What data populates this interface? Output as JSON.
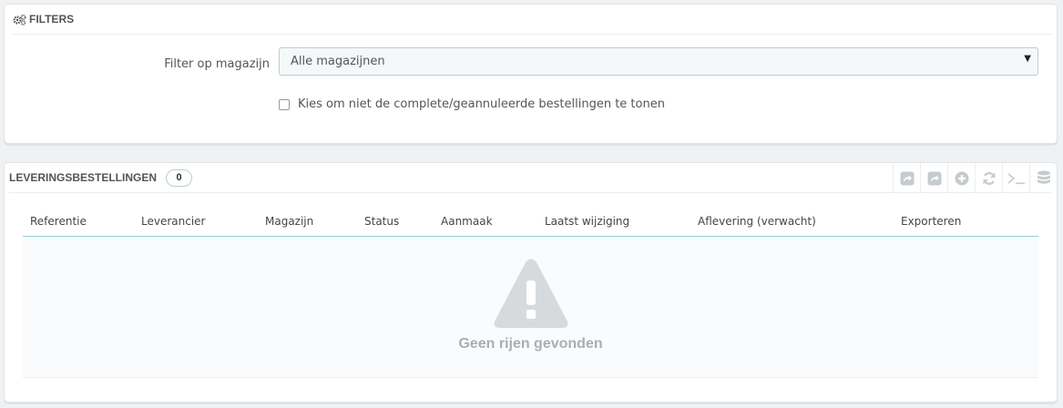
{
  "filters": {
    "title": "FILTERS",
    "warehouse_label": "Filter op magazijn",
    "warehouse_selected": "Alle magazijnen",
    "hide_completed_label": "Kies om niet de complete/geannuleerde bestellingen te tonen",
    "hide_completed_checked": false
  },
  "orders": {
    "title": "LEVERINGSBESTELLINGEN",
    "count": "0",
    "toolbar_icons": [
      "export-icon",
      "export-icon",
      "add-icon",
      "refresh-icon",
      "sql-query-icon",
      "database-icon"
    ],
    "columns": [
      "Referentie",
      "Leverancier",
      "Magazijn",
      "Status",
      "Aanmaak",
      "Laatst wijziging",
      "Aflevering (verwacht)",
      "Exporteren"
    ],
    "empty_message": "Geen rijen gevonden"
  }
}
